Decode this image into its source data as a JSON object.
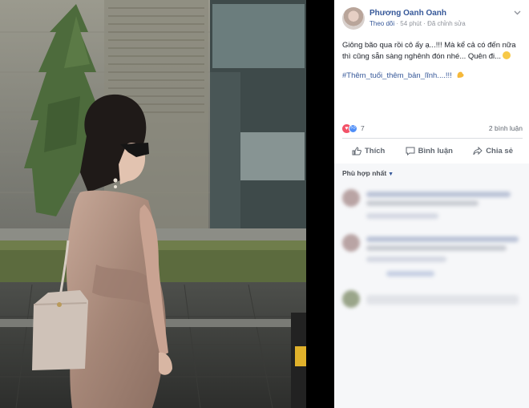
{
  "post": {
    "author": "Phương Oanh Oanh",
    "follow_label": "Theo dõi",
    "time": "54 phút",
    "edited": "Đã chỉnh sửa",
    "separator": "·",
    "text": "Giông bão qua rồi cô ấy ạ...!!! Mà kể cả có đến nữa thì cũng sẵn sàng nghênh đón nhé... Quên đi...",
    "hashtag": "#Thêm_tuổi_thêm_bản_lĩnh....!!!"
  },
  "reactions": {
    "count": "7",
    "comments": "2 bình luận",
    "heart_icon": "heart-icon",
    "like_icon": "like-icon"
  },
  "actions": {
    "like": "Thích",
    "comment": "Bình luận",
    "share": "Chia sẻ"
  },
  "comments": {
    "sort_label": "Phù hợp nhất"
  },
  "colors": {
    "link": "#365899",
    "muted": "#90949c",
    "heart": "#f25268",
    "like": "#4f8ef7"
  }
}
